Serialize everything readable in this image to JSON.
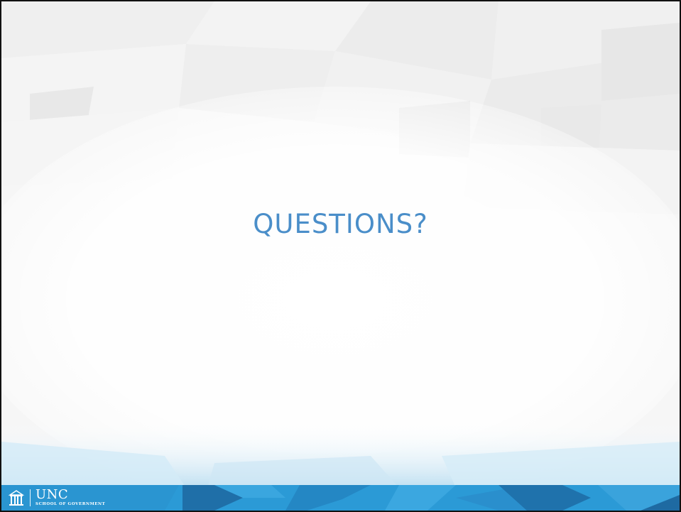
{
  "slide": {
    "title": "QUESTIONS?"
  },
  "footer": {
    "logo": {
      "icon": "old-well-icon",
      "main_text": "UNC",
      "sub_text": "SCHOOL OF GOVERNMENT"
    }
  },
  "colors": {
    "title": "#4a8ec9",
    "footer_blue": "#2b9ad6",
    "footer_dark": "#1f6fa8"
  }
}
